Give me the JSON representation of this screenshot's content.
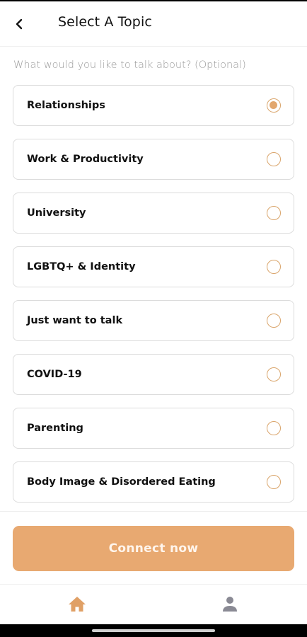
{
  "header": {
    "title": "Select A Topic"
  },
  "subtitle": "What would you like to talk about? (Optional)",
  "topics": [
    {
      "label": "Relationships",
      "selected": true
    },
    {
      "label": "Work & Productivity",
      "selected": false
    },
    {
      "label": "University",
      "selected": false
    },
    {
      "label": "LGBTQ+ & Identity",
      "selected": false
    },
    {
      "label": "Just want to talk",
      "selected": false
    },
    {
      "label": "COVID-19",
      "selected": false
    },
    {
      "label": "Parenting",
      "selected": false
    },
    {
      "label": "Body Image & Disordered Eating",
      "selected": false
    }
  ],
  "connect_button": {
    "label": "Connect now"
  },
  "bottom_nav": {
    "items": [
      {
        "icon": "home-icon",
        "active": true
      },
      {
        "icon": "profile-icon",
        "active": false
      }
    ]
  },
  "colors": {
    "accent": "#e8a971",
    "radio_border": "#d9a46a",
    "nav_active": "#e0a066",
    "nav_inactive": "#8a8a94"
  }
}
